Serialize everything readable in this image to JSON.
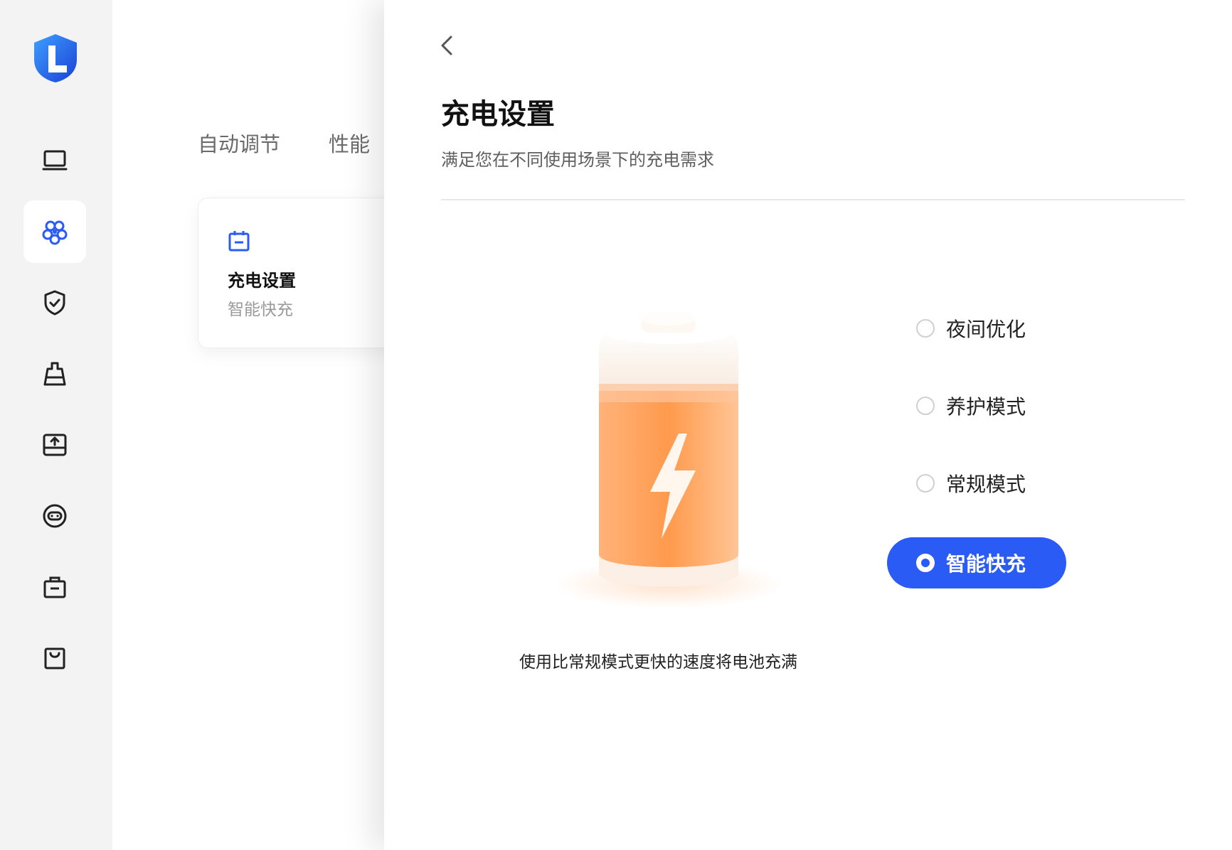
{
  "nav": {
    "items": [
      {
        "name": "device-icon"
      },
      {
        "name": "optimize-icon",
        "active": true
      },
      {
        "name": "shield-check-icon"
      },
      {
        "name": "clean-icon"
      },
      {
        "name": "drive-upload-icon"
      },
      {
        "name": "support-chat-icon"
      },
      {
        "name": "toolbox-icon"
      },
      {
        "name": "shopping-bag-icon"
      }
    ]
  },
  "background_page": {
    "tabs": [
      "自动调节",
      "性能"
    ],
    "card": {
      "title": "充电设置",
      "subtitle": "智能快充"
    }
  },
  "drawer": {
    "title": "充电设置",
    "subtitle": "满足您在不同使用场景下的充电需求",
    "options": [
      {
        "label": "夜间优化",
        "selected": false
      },
      {
        "label": "养护模式",
        "selected": false
      },
      {
        "label": "常规模式",
        "selected": false
      },
      {
        "label": "智能快充",
        "selected": true
      }
    ],
    "description": "使用比常规模式更快的速度将电池充满"
  },
  "colors": {
    "accent": "#2b5bf5",
    "battery": "#ff9a4d"
  }
}
